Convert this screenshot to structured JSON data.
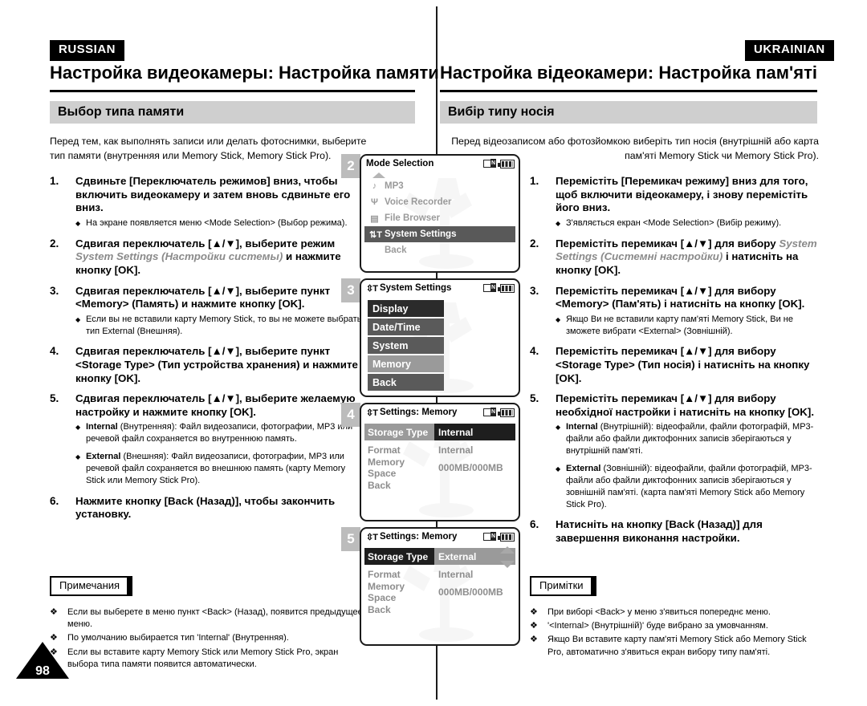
{
  "left": {
    "lang_tag": "RUSSIAN",
    "chapter_title": "Настройка видеокамеры: Настройка памяти",
    "section_title": "Выбор типа памяти",
    "intro": "Перед тем, как выполнять записи или делать фотоснимки, выберите тип памяти (внутренняя или Memory Stick, Memory Stick Pro).",
    "steps": [
      {
        "num": "1.",
        "title_pre": "Сдвиньте [Переключатель режимов] вниз, чтобы включить видеокамеру и затем вновь сдвиньте его вниз.",
        "title_italic": "",
        "title_post": "",
        "bullets": [
          "На экране появляется меню <Mode Selection> (Выбор режима)."
        ]
      },
      {
        "num": "2.",
        "title_pre": "Сдвигая переключатель [▲/▼], выберите режим ",
        "title_italic": "System Settings (Настройки системы)",
        "title_post": " и нажмите кнопку [OK].",
        "bullets": []
      },
      {
        "num": "3.",
        "title_pre": "Сдвигая переключатель [▲/▼], выберите пункт <Memory> (Память) и нажмите кнопку [OK].",
        "title_italic": "",
        "title_post": "",
        "bullets": [
          "Если вы не вставили карту Memory Stick, то вы не можете выбрать тип External (Внешняя)."
        ]
      },
      {
        "num": "4.",
        "title_pre": "Сдвигая переключатель [▲/▼], выберите пункт <Storage Type> (Тип устройства хранения) и нажмите кнопку [OK].",
        "title_italic": "",
        "title_post": "",
        "bullets": []
      },
      {
        "num": "5.",
        "title_pre": "Сдвигая переключатель [▲/▼], выберите желаемую настройку и нажмите кнопку [OK].",
        "title_italic": "",
        "title_post": "",
        "bullets": [
          "Internal (Внутренняя): Файл видеозаписи, фотографии, MP3 или речевой файл сохраняется во внутреннюю память.",
          "External (Внешняя): Файл видеозаписи, фотографии, MP3 или речевой файл сохраняется во внешнюю память (карту Memory Stick или Memory Stick Pro)."
        ],
        "bullets_bold_lead": [
          "Internal",
          "External"
        ]
      },
      {
        "num": "6.",
        "title_pre": "Нажмите кнопку [Back (Назад)], чтобы закончить установку.",
        "title_italic": "",
        "title_post": "",
        "bullets": []
      }
    ],
    "notes_label": "Примечания",
    "notes": [
      "Если вы выберете в меню пункт <Back> (Назад), появится предыдущее меню.",
      "По умолчанию выбирается тип 'Internal' (Внутренняя).",
      "Если вы вставите карту Memory Stick или Memory Stick Pro, экран выбора типа памяти появится автоматически."
    ]
  },
  "right": {
    "lang_tag": "UKRAINIAN",
    "chapter_title": "Настройка відеокамери: Настройка пам'яті",
    "section_title": "Вибір типу носія",
    "intro": "Перед відеозаписом або фотозйомкою виберіть тип носія (внутрішній або карта пам'яті Memory Stick чи Memory Stick Pro).",
    "steps": [
      {
        "num": "1.",
        "title_pre": "Перемістіть [Перемикач режиму] вниз для того, щоб включити відеокамеру, і знову перемістіть його вниз.",
        "title_italic": "",
        "title_post": "",
        "bullets": [
          "З'являється екран <Mode Selection> (Вибір режиму)."
        ]
      },
      {
        "num": "2.",
        "title_pre": "Перемістіть перемикач [▲/▼] для вибору ",
        "title_italic": "System Settings (Системні настройки)",
        "title_post": " і натисніть на кнопку [OK].",
        "bullets": []
      },
      {
        "num": "3.",
        "title_pre": "Перемістіть перемикач [▲/▼] для вибору <Memory> (Пам'ять) і натисніть на кнопку [OK].",
        "title_italic": "",
        "title_post": "",
        "bullets": [
          "Якщо Ви не вставили карту пам'яті Memory Stick, Ви не зможете вибрати <External> (Зовнішній)."
        ]
      },
      {
        "num": "4.",
        "title_pre": "Перемістіть перемикач [▲/▼] для вибору <Storage Type> (Тип носія) і натисніть на кнопку [OK].",
        "title_italic": "",
        "title_post": "",
        "bullets": []
      },
      {
        "num": "5.",
        "title_pre": "Перемістіть перемикач [▲/▼] для вибору необхідної настройки і натисніть на кнопку [OK].",
        "title_italic": "",
        "title_post": "",
        "bullets": [
          "Internal (Внутрішній): відеофайли, файли фотографій, MP3-файли або файли диктофонних записів зберігаються у внутрішній пам'яті.",
          "External (Зовнішній): відеофайли, файли фотографій, MP3-файли або файли диктофонних записів зберігаються у зовнішній пам'яті. (карта пам'яті Memory Stick або Memory Stick Pro)."
        ],
        "bullets_bold_lead": [
          "Internal",
          "External"
        ]
      },
      {
        "num": "6.",
        "title_pre": "Натисніть на кнопку [Back (Назад)] для завершення виконання настройки.",
        "title_italic": "",
        "title_post": "",
        "bullets": []
      }
    ],
    "notes_label": "Примітки",
    "notes": [
      "При виборі <Back> у меню з'явиться попереднє меню.",
      "'<Internal> (Внутрішній)' буде вибрано за умовчанням.",
      "Якщо Ви вставите карту пам'яті Memory Stick або Memory Stick Pro, автоматично з'явиться екран вибору типу пам'яті."
    ]
  },
  "screens": [
    {
      "badge": "2",
      "type": "menu",
      "title": "Mode Selection",
      "title_icon": "",
      "has_up_arrow": true,
      "rows": [
        {
          "icon": "♪",
          "icon_name": "music-note-icon",
          "label": "MP3",
          "selected": false
        },
        {
          "icon": "Ψ",
          "icon_name": "microphone-icon",
          "label": "Voice Recorder",
          "selected": false
        },
        {
          "icon": "▤",
          "icon_name": "document-icon",
          "label": "File Browser",
          "selected": false
        },
        {
          "icon": "⇅T",
          "icon_name": "tools-icon",
          "label": "System Settings",
          "selected": true
        },
        {
          "icon": "",
          "icon_name": "blank-icon",
          "label": "Back",
          "selected": false
        }
      ]
    },
    {
      "badge": "3",
      "type": "buttons",
      "title": "System Settings",
      "title_icon": "tools-icon",
      "rows": [
        {
          "label": "Display",
          "shade": "dark"
        },
        {
          "label": "Date/Time",
          "shade": "mid"
        },
        {
          "label": "System",
          "shade": "mid"
        },
        {
          "label": "Memory",
          "shade": "light"
        },
        {
          "label": "Back",
          "shade": "mid"
        }
      ]
    },
    {
      "badge": "4",
      "type": "kv",
      "title": "Settings: Memory",
      "title_icon": "tools-icon",
      "scroll_arrows": false,
      "rows": [
        {
          "key": "Storage Type",
          "value": "Internal",
          "highlight": "value"
        },
        {
          "key": "Format",
          "value": "Internal",
          "highlight": "none"
        },
        {
          "key": "Memory Space",
          "value": "000MB/000MB",
          "highlight": "none"
        },
        {
          "key": "Back",
          "value": "",
          "highlight": "none"
        }
      ]
    },
    {
      "badge": "5",
      "type": "kv",
      "title": "Settings: Memory",
      "title_icon": "tools-icon",
      "scroll_arrows": true,
      "rows": [
        {
          "key": "Storage Type",
          "value": "External",
          "highlight": "key"
        },
        {
          "key": "Format",
          "value": "Internal",
          "highlight": "none"
        },
        {
          "key": "Memory Space",
          "value": "000MB/000MB",
          "highlight": "none"
        },
        {
          "key": "Back",
          "value": "",
          "highlight": "none"
        }
      ]
    }
  ],
  "page_number": "98",
  "colors": {
    "tag_bg": "#000000",
    "section_bar": "#cfcfcf",
    "badge_bg": "#bcbcbc",
    "lcd_border": "#1a1a1a",
    "selected_row": "#595959",
    "btn_dark": "#2b2b2b",
    "btn_mid": "#5a5a5a",
    "btn_light": "#9a9a9a",
    "grey_text": "#8d8d8d"
  }
}
